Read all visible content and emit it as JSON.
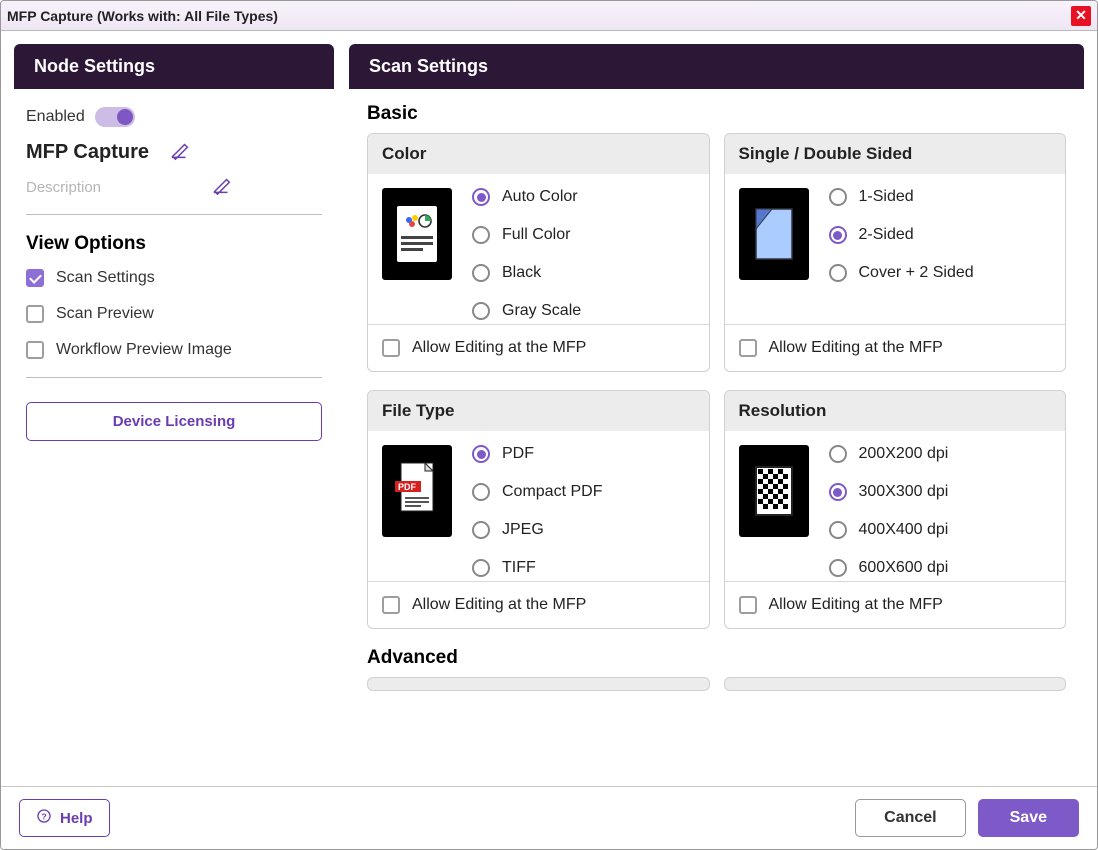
{
  "window": {
    "title": "MFP Capture  (Works with: All File Types)"
  },
  "left": {
    "header": "Node Settings",
    "enabled_label": "Enabled",
    "enabled": true,
    "name": "MFP Capture",
    "description_placeholder": "Description",
    "view_options_header": "View Options",
    "options": [
      {
        "label": "Scan Settings",
        "checked": true
      },
      {
        "label": "Scan Preview",
        "checked": false
      },
      {
        "label": "Workflow Preview Image",
        "checked": false
      }
    ],
    "device_button": "Device Licensing"
  },
  "right": {
    "header": "Scan Settings",
    "basic_header": "Basic",
    "advanced_header": "Advanced",
    "allow_edit_label": "Allow Editing at the MFP",
    "cards": {
      "color": {
        "title": "Color",
        "options": [
          "Auto Color",
          "Full Color",
          "Black",
          "Gray Scale"
        ],
        "selected": 0,
        "allow_edit": false
      },
      "sides": {
        "title": "Single / Double Sided",
        "options": [
          "1-Sided",
          "2-Sided",
          "Cover + 2 Sided"
        ],
        "selected": 1,
        "allow_edit": false
      },
      "file_type": {
        "title": "File Type",
        "options": [
          "PDF",
          "Compact PDF",
          "JPEG",
          "TIFF"
        ],
        "selected": 0,
        "allow_edit": false
      },
      "resolution": {
        "title": "Resolution",
        "options": [
          "200X200 dpi",
          "300X300 dpi",
          "400X400 dpi",
          "600X600 dpi"
        ],
        "selected": 1,
        "allow_edit": false
      }
    }
  },
  "footer": {
    "help": "Help",
    "cancel": "Cancel",
    "save": "Save"
  }
}
